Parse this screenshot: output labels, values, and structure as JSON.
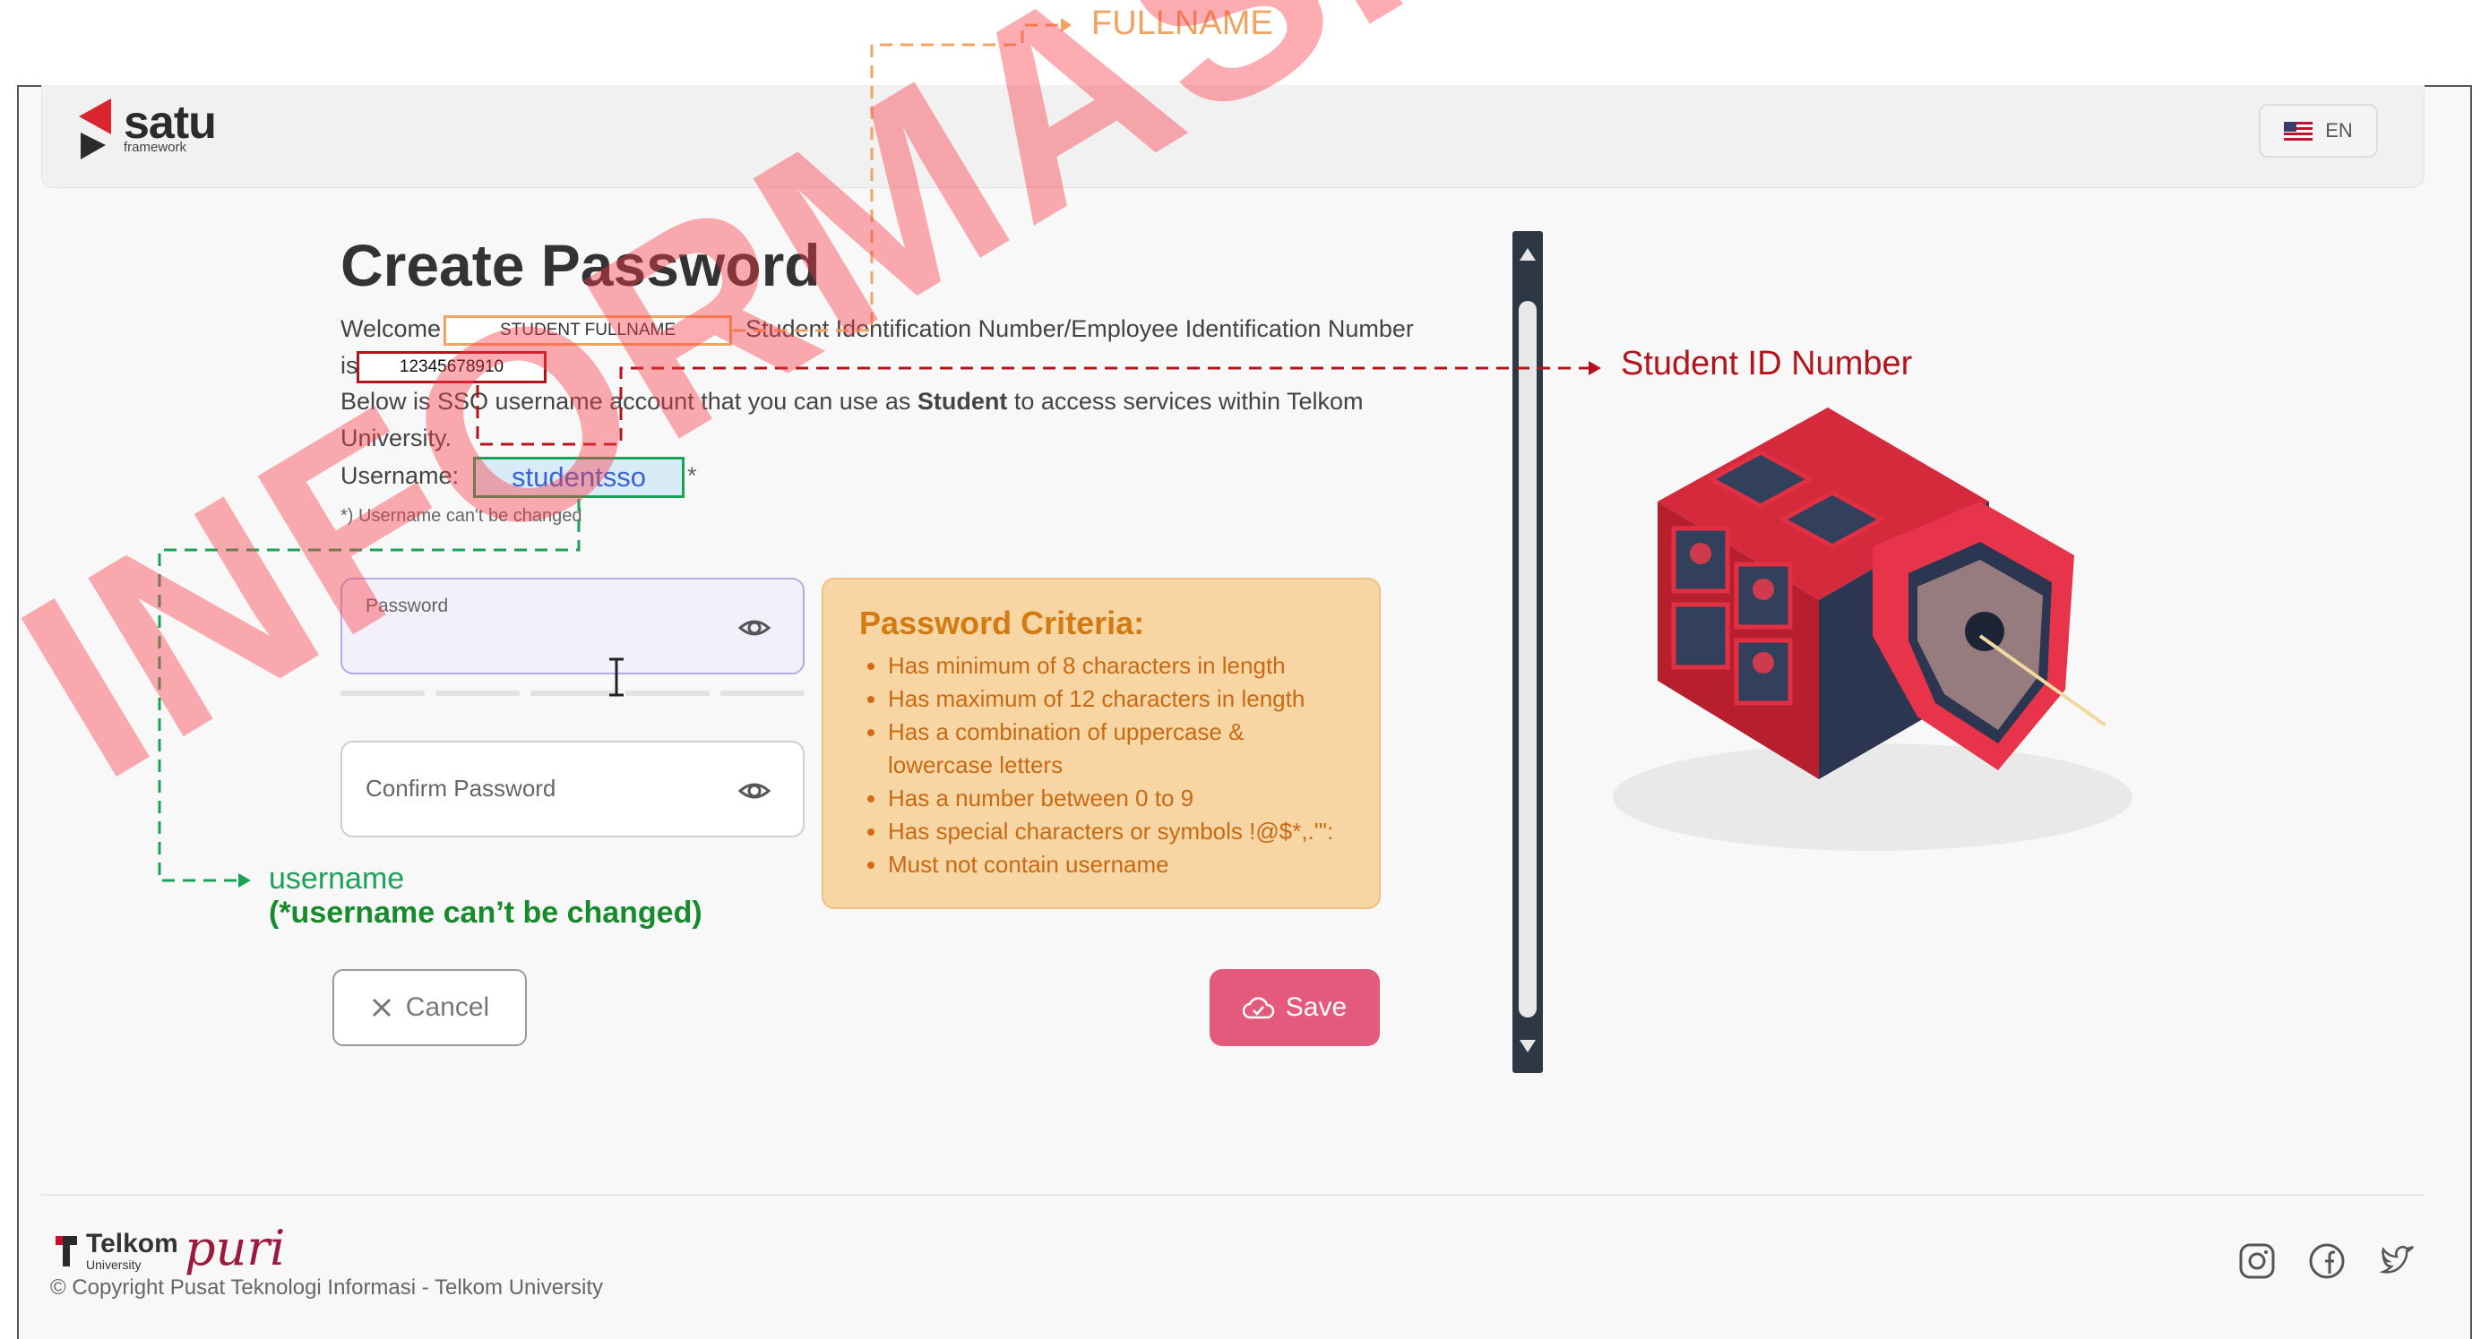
{
  "header": {
    "logo_text": "satu",
    "logo_sub": "framework",
    "language_label": "EN"
  },
  "main": {
    "title": "Create Password",
    "welcome_prefix": "Welcome",
    "fullname_placeholder": "STUDENT FULLNAME",
    "welcome_suffix": "Student Identification Number/Employee Identification Number",
    "is_label": "is",
    "student_id": "12345678910",
    "desc_line1_a": "Below is SSO username account that you can use as ",
    "desc_line1_bold": "Student",
    "desc_line1_b": " to access services within Telkom",
    "desc_line2": "University.",
    "username_label": "Username:",
    "username_value": "studentsso",
    "required_mark": "*",
    "username_note": "*) Username can't be changed",
    "password_label": "Password",
    "password_value": "",
    "confirm_password_label": "Confirm Password",
    "confirm_password_value": "",
    "password_strength_segments": 5,
    "criteria": {
      "title": "Password Criteria:",
      "items": [
        "Has minimum of 8 characters in length",
        "Has maximum of 12 characters in length",
        "Has a combination of uppercase &",
        "lowercase letters",
        "Has a number between 0 to 9",
        "Has special characters or symbols !@$*,.'\":",
        "Must not contain username"
      ]
    },
    "cancel_label": "Cancel",
    "save_label": "Save"
  },
  "footer": {
    "telkom_label": "Telkom",
    "telkom_sub": "University",
    "puri_label": "puri",
    "copyright": "© Copyright Pusat Teknologi Informasi - Telkom University",
    "social_icons": [
      "instagram-icon",
      "facebook-icon",
      "twitter-icon"
    ]
  },
  "annotations": {
    "fullname": "FULLNAME",
    "student_id_number": "Student ID Number",
    "username": "username",
    "username_note": "(*username can’t be changed)"
  },
  "watermark": "INFORMASI PUBLIK",
  "colors": {
    "accent_save": "#e35a7c",
    "criteria_bg": "#f8d6a4",
    "criteria_text": "#c86a14",
    "annot_fullname": "#f0a460",
    "annot_student_id": "#b3141b",
    "annot_username": "#1aa356",
    "watermark": "#fa3c46"
  }
}
